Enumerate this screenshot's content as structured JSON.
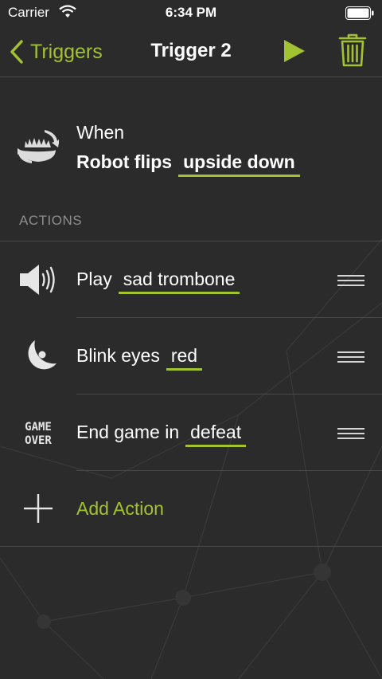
{
  "status_bar": {
    "carrier": "Carrier",
    "time": "6:34 PM"
  },
  "nav": {
    "back_label": "Triggers",
    "title": "Trigger 2"
  },
  "when": {
    "label": "When",
    "subject": "Robot flips",
    "value": "upside down"
  },
  "actions_header": "ACTIONS",
  "actions": [
    {
      "prefix": "Play",
      "value": "sad trombone",
      "icon": "speaker-icon"
    },
    {
      "prefix": "Blink eyes",
      "value": "red",
      "icon": "eye-icon"
    },
    {
      "prefix": "End game in",
      "value": "defeat",
      "icon": "game-over-icon"
    }
  ],
  "game_over_icon_text": {
    "line1": "GAME",
    "line2": "OVER"
  },
  "add_action_label": "Add Action",
  "colors": {
    "accent": "#a3c232",
    "background": "#2b2b2b",
    "divider": "#4a4a4a",
    "muted": "#8e8e8e"
  }
}
